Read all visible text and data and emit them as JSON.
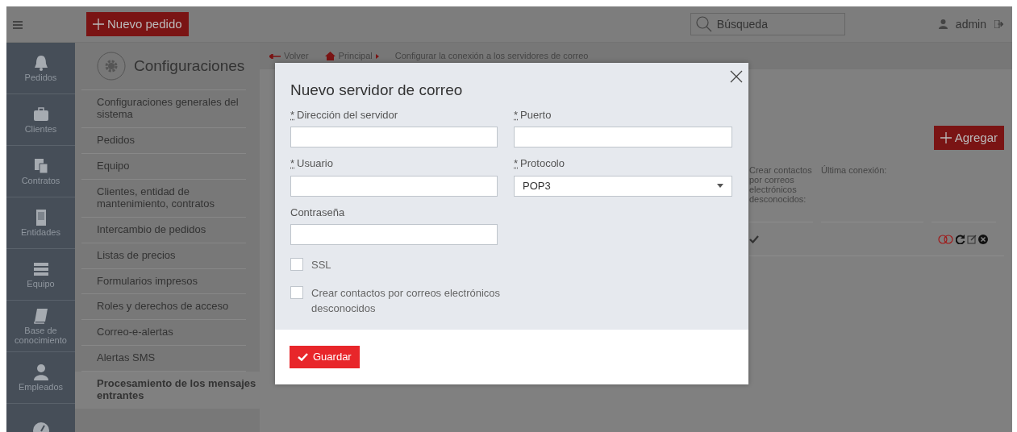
{
  "topbar": {
    "new_order_button": "Nuevo pedido",
    "search": {
      "placeholder": "Búsqueda"
    },
    "user": "admin"
  },
  "nav": [
    {
      "label": "Pedidos"
    },
    {
      "label": "Clientes"
    },
    {
      "label": "Contratos"
    },
    {
      "label": "Entidades"
    },
    {
      "label": "Equipo"
    },
    {
      "label": "Base de conocimiento"
    },
    {
      "label": "Empleados"
    }
  ],
  "settings": {
    "title": "Configuraciones",
    "items": [
      {
        "label": "Configuraciones generales del sistema",
        "selected": false
      },
      {
        "label": "Pedidos",
        "selected": false
      },
      {
        "label": "Equipo",
        "selected": false
      },
      {
        "label": "Clientes, entidad de mantenimiento, contratos",
        "selected": false
      },
      {
        "label": "Intercambio de pedidos",
        "selected": false
      },
      {
        "label": "Listas de precios",
        "selected": false
      },
      {
        "label": "Formularios impresos",
        "selected": false
      },
      {
        "label": "Roles y derechos de acceso",
        "selected": false
      },
      {
        "label": "Correo-e-alertas",
        "selected": false
      },
      {
        "label": "Alertas SMS",
        "selected": false
      },
      {
        "label": "Procesamiento de los mensajes entrantes",
        "selected": true
      }
    ]
  },
  "breadcrumb": {
    "back": "Volver",
    "home": "Principal",
    "current": "Configurar la conexión a los servidores de correo"
  },
  "add_button": "Agregar",
  "table": {
    "columns": [
      "Crear contactos por correos electrónicos desconocidos:",
      "Última conexión:"
    ],
    "rows": [
      {
        "create_contacts": true
      }
    ]
  },
  "dialog": {
    "title": "Nuevo servidor de correo",
    "fields": [
      {
        "label": "Dirección del servidor",
        "required_mark": "*",
        "kind": "text"
      },
      {
        "label": "Puerto",
        "required_mark": "*",
        "kind": "text"
      },
      {
        "label": "Usuario",
        "required_mark": "*",
        "kind": "text"
      },
      {
        "label": "Protocolo",
        "required_mark": "*",
        "kind": "select",
        "value": "POP3"
      },
      {
        "label": "Contraseña",
        "kind": "text"
      }
    ],
    "checkboxes": [
      {
        "label": "SSL",
        "checked": false
      },
      {
        "label": "Crear contactos por correos electrónicos desconocidos",
        "checked": false
      }
    ],
    "save_button": "Guardar"
  }
}
